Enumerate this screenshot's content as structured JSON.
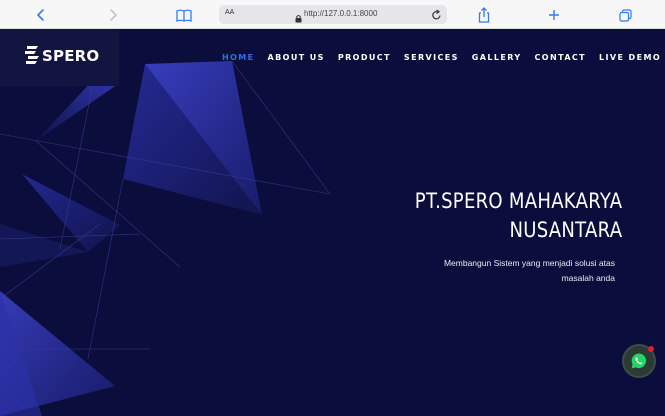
{
  "browser": {
    "text_size_label": "AA",
    "url": "http://127.0.0.1:8000",
    "icons": [
      "back-icon",
      "forward-icon",
      "bookmarks-icon",
      "lock-icon",
      "reload-icon",
      "share-icon",
      "new-tab-icon",
      "tabs-icon"
    ]
  },
  "site": {
    "logo_text": "SPERO",
    "nav": [
      {
        "label": "HOME",
        "active": true
      },
      {
        "label": "ABOUT US",
        "active": false
      },
      {
        "label": "PRODUCT",
        "active": false
      },
      {
        "label": "SERVICES",
        "active": false
      },
      {
        "label": "GALLERY",
        "active": false
      },
      {
        "label": "CONTACT",
        "active": false
      },
      {
        "label": "LIVE DEMO",
        "active": false
      }
    ],
    "hero": {
      "title_line1": "PT.SPERO MAHAKARYA",
      "title_line2": "NUSANTARA",
      "subtitle_line1": "Membangun Sistem yang menjadi solusi atas",
      "subtitle_line2": "masalah anda"
    },
    "whatsapp_icon": "whatsapp-icon"
  },
  "colors": {
    "background": "#0b0e3c",
    "accent": "#2f6ee8",
    "triangle": "#2a2f9c",
    "whatsapp_dot": "#e11d2a"
  }
}
